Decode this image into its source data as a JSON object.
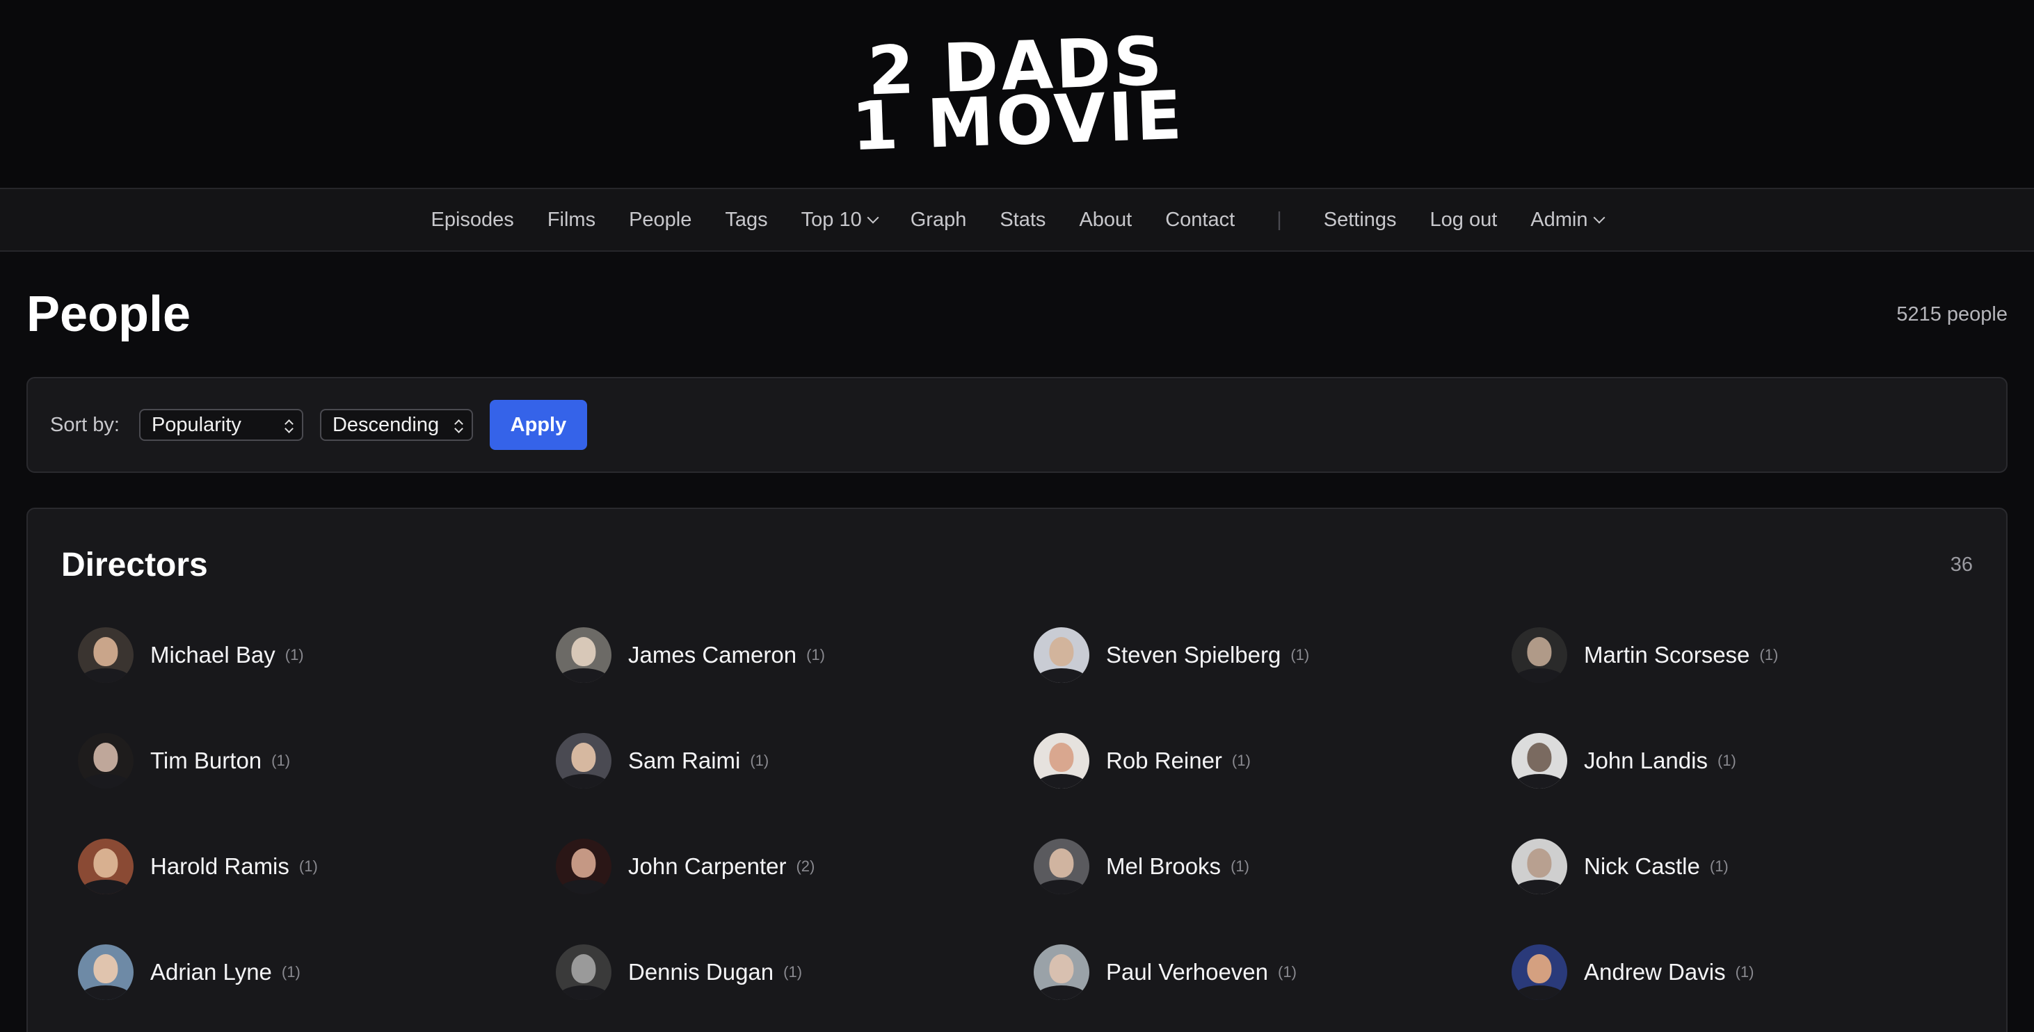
{
  "logo": {
    "line1": "2 DADS",
    "line2": "1 MOVIE"
  },
  "nav": {
    "items": [
      "Episodes",
      "Films",
      "People",
      "Tags",
      "Top 10",
      "Graph",
      "Stats",
      "About",
      "Contact"
    ],
    "separator": "|",
    "right_items": [
      "Settings",
      "Log out",
      "Admin"
    ]
  },
  "page": {
    "title": "People",
    "count": "5215 people"
  },
  "sort": {
    "label": "Sort by:",
    "field": "Popularity",
    "order": "Descending",
    "apply_label": "Apply"
  },
  "directors": {
    "title": "Directors",
    "count": "36",
    "people": [
      {
        "name": "Michael Bay",
        "count": "(1)",
        "avatar_bg": "#3a3430",
        "skin": "#c9a58a"
      },
      {
        "name": "James Cameron",
        "count": "(1)",
        "avatar_bg": "#6c6a66",
        "skin": "#d8c8b8"
      },
      {
        "name": "Steven Spielberg",
        "count": "(1)",
        "avatar_bg": "#c9ccd4",
        "skin": "#d2b49c"
      },
      {
        "name": "Martin Scorsese",
        "count": "(1)",
        "avatar_bg": "#2a2a2a",
        "skin": "#b09a88"
      },
      {
        "name": "Tim Burton",
        "count": "(1)",
        "avatar_bg": "#1e1c1c",
        "skin": "#bfa79a"
      },
      {
        "name": "Sam Raimi",
        "count": "(1)",
        "avatar_bg": "#4a4a52",
        "skin": "#d6b8a0"
      },
      {
        "name": "Rob Reiner",
        "count": "(1)",
        "avatar_bg": "#e6e2de",
        "skin": "#d9a78f"
      },
      {
        "name": "John Landis",
        "count": "(1)",
        "avatar_bg": "#dcdcdc",
        "skin": "#7a6a60"
      },
      {
        "name": "Harold Ramis",
        "count": "(1)",
        "avatar_bg": "#8a4a34",
        "skin": "#d8b090"
      },
      {
        "name": "John Carpenter",
        "count": "(2)",
        "avatar_bg": "#2a1616",
        "skin": "#c59884"
      },
      {
        "name": "Mel Brooks",
        "count": "(1)",
        "avatar_bg": "#5a5a5e",
        "skin": "#d0b4a0"
      },
      {
        "name": "Nick Castle",
        "count": "(1)",
        "avatar_bg": "#cfcfcf",
        "skin": "#b8a090"
      },
      {
        "name": "Adrian Lyne",
        "count": "(1)",
        "avatar_bg": "#6e8aa6",
        "skin": "#e0c4ae"
      },
      {
        "name": "Dennis Dugan",
        "count": "(1)",
        "avatar_bg": "#3a3a3a",
        "skin": "#9a9a9a"
      },
      {
        "name": "Paul Verhoeven",
        "count": "(1)",
        "avatar_bg": "#9aa2a8",
        "skin": "#d8c0b0"
      },
      {
        "name": "Andrew Davis",
        "count": "(1)",
        "avatar_bg": "#2a3a7a",
        "skin": "#d4a080"
      }
    ]
  }
}
